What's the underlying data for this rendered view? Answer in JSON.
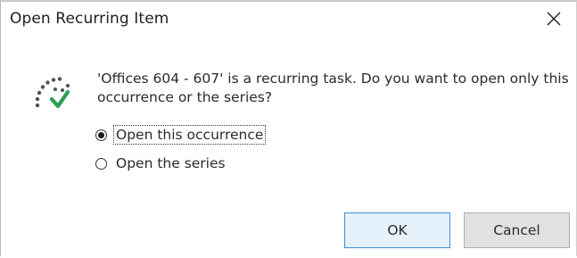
{
  "window": {
    "title": "Open Recurring Item"
  },
  "icons": {
    "close": "close-icon",
    "task": "recurring-task-icon"
  },
  "message": "'Offices 604 - 607' is a recurring task. Do you want to open only this occurrence or the series?",
  "options": [
    {
      "label": "Open this occurrence",
      "selected": true
    },
    {
      "label": "Open the series",
      "selected": false
    }
  ],
  "buttons": {
    "ok": "OK",
    "cancel": "Cancel"
  },
  "colors": {
    "icon_dark": "#4b5257",
    "icon_accent": "#2e9e52",
    "ok_border": "#3c8ed8",
    "ok_fill": "#e5f1fb"
  }
}
